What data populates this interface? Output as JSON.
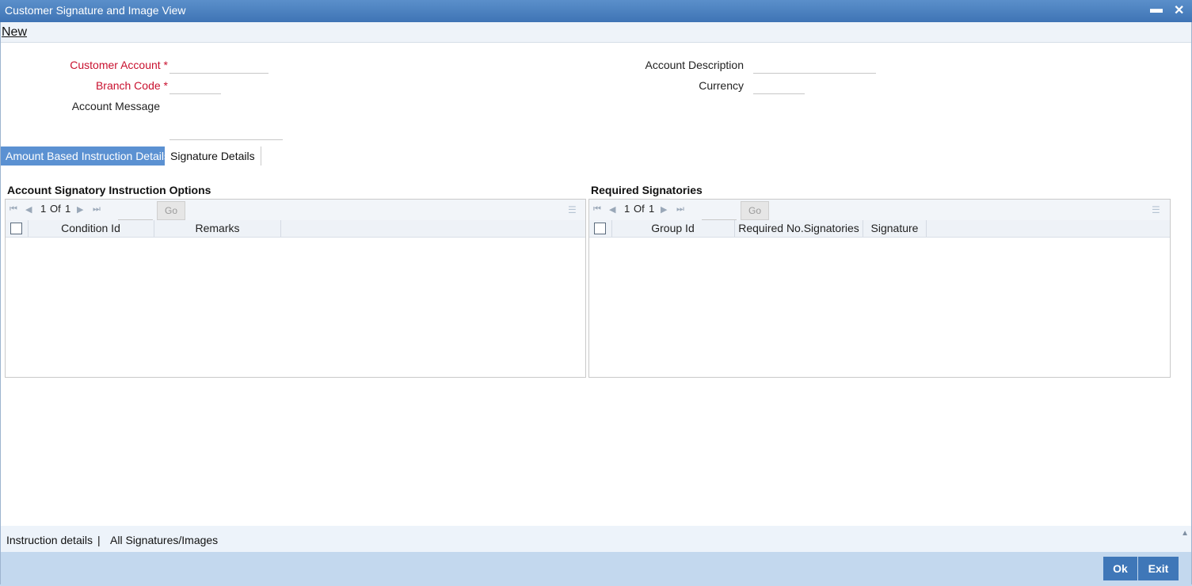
{
  "window": {
    "title": "Customer Signature and Image View",
    "minimize_symbol": "▬",
    "close_symbol": "✕"
  },
  "menu": {
    "new_label": "New"
  },
  "form": {
    "customer_account_label": "Customer Account",
    "branch_code_label": "Branch Code",
    "required_marker": "*",
    "account_message_label": "Account Message",
    "account_description_label": "Account Description",
    "currency_label": "Currency",
    "customer_account_value": "",
    "branch_code_value": "",
    "account_message_value": "",
    "account_description_value": "",
    "currency_value": ""
  },
  "tabs": [
    {
      "label": "Amount Based Instruction Details",
      "active": true
    },
    {
      "label": "Signature Details",
      "active": false
    }
  ],
  "left_grid": {
    "title": "Account Signatory Instruction Options",
    "page_current": "1",
    "page_of": "Of",
    "page_total": "1",
    "go_label": "Go",
    "columns": [
      "Condition Id",
      "Remarks"
    ]
  },
  "right_grid": {
    "title": "Required Signatories",
    "page_current": "1",
    "page_of": "Of",
    "page_total": "1",
    "go_label": "Go",
    "columns": [
      "Group Id",
      "Required No.Signatories",
      "Signature"
    ]
  },
  "footer_links": {
    "instruction_details": "Instruction details",
    "separator": "|",
    "all_signatures": "All Signatures/Images"
  },
  "buttons": {
    "ok": "Ok",
    "exit": "Exit"
  },
  "colors": {
    "titlebar": "#3f74b5",
    "active_tab": "#5b91d2",
    "required": "#c8102e",
    "button": "#3f77b8",
    "bottom_bar": "#c3d8ee"
  }
}
